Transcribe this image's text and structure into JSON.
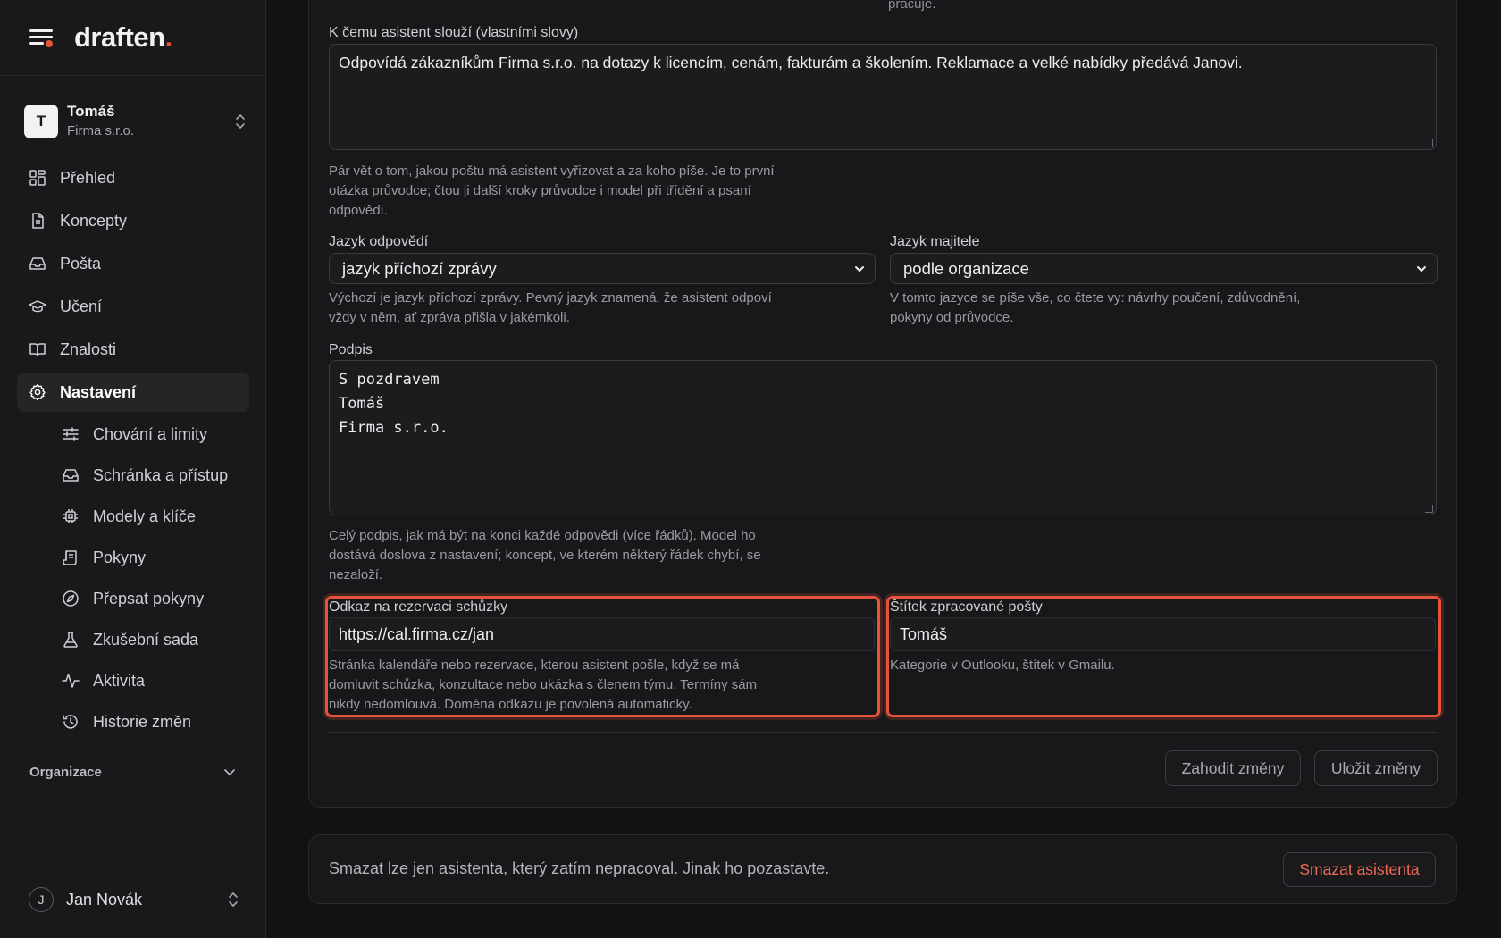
{
  "brand": {
    "name": "draften",
    "dot": "."
  },
  "account": {
    "initial": "T",
    "name": "Tomáš",
    "org": "Firma s.r.o."
  },
  "nav": [
    {
      "label": "Přehled",
      "icon": "dashboard-icon"
    },
    {
      "label": "Koncepty",
      "icon": "document-icon"
    },
    {
      "label": "Pošta",
      "icon": "inbox-icon"
    },
    {
      "label": "Učení",
      "icon": "graduation-cap-icon"
    },
    {
      "label": "Znalosti",
      "icon": "book-icon"
    },
    {
      "label": "Nastavení",
      "icon": "gear-icon",
      "active": true
    }
  ],
  "subnav": [
    {
      "label": "Chování a limity",
      "icon": "sliders-icon"
    },
    {
      "label": "Schránka a přístup",
      "icon": "inbox-icon"
    },
    {
      "label": "Modely a klíče",
      "icon": "chip-icon"
    },
    {
      "label": "Pokyny",
      "icon": "scroll-icon"
    },
    {
      "label": "Přepsat pokyny",
      "icon": "compass-icon"
    },
    {
      "label": "Zkušební sada",
      "icon": "flask-icon"
    },
    {
      "label": "Aktivita",
      "icon": "activity-icon"
    },
    {
      "label": "Historie změn",
      "icon": "history-icon"
    }
  ],
  "org_section": {
    "label": "Organizace"
  },
  "user": {
    "initial": "J",
    "name": "Jan Novák"
  },
  "form": {
    "prev_text": "pracuje.",
    "purpose": {
      "label": "K čemu asistent slouží (vlastními slovy)",
      "value": "Odpovídá zákazníkům Firma s.r.o. na dotazy k licencím, cenám, fakturám a školením. Reklamace a velké nabídky předává Janovi.",
      "help": "Pár vět o tom, jakou poštu má asistent vyřizovat a za koho píše. Je to první otázka průvodce; čtou ji další kroky průvodce i model při třídění a psaní odpovědí."
    },
    "reply_lang": {
      "label": "Jazyk odpovědí",
      "value": "jazyk příchozí zprávy",
      "help": "Výchozí je jazyk příchozí zprávy. Pevný jazyk znamená, že asistent odpoví vždy v něm, ať zpráva přišla v jakémkoli."
    },
    "owner_lang": {
      "label": "Jazyk majitele",
      "value": "podle organizace",
      "help": "V tomto jazyce se píše vše, co čtete vy: návrhy poučení, zdůvodnění, pokyny od průvodce."
    },
    "signature": {
      "label": "Podpis",
      "lines": [
        "S pozdravem",
        "Tomáš",
        "Firma s.r.o."
      ],
      "help": "Celý podpis, jak má být na konci každé odpovědi (více řádků). Model ho dostává doslova z nastavení; koncept, ve kterém některý řádek chybí, se nezaloží."
    },
    "booking": {
      "label": "Odkaz na rezervaci schůzky",
      "value": "https://cal.firma.cz/jan",
      "help": "Stránka kalendáře nebo rezervace, kterou asistent pošle, když se má domluvit schůzka, konzultace nebo ukázka s členem týmu. Termíny sám nikdy nedomlouvá. Doména odkazu je povolená automaticky."
    },
    "mail_tag": {
      "label": "Štítek zpracované pošty",
      "value": "Tomáš",
      "help": "Kategorie v Outlooku, štítek v Gmailu."
    },
    "discard_label": "Zahodit změny",
    "save_label": "Uložit změny"
  },
  "danger": {
    "text": "Smazat lze jen asistenta, který zatím nepracoval. Jinak ho pozastavte.",
    "button": "Smazat asistenta"
  },
  "colors": {
    "accent": "#e5533d",
    "background": "#121214",
    "panel": "#18181a"
  }
}
